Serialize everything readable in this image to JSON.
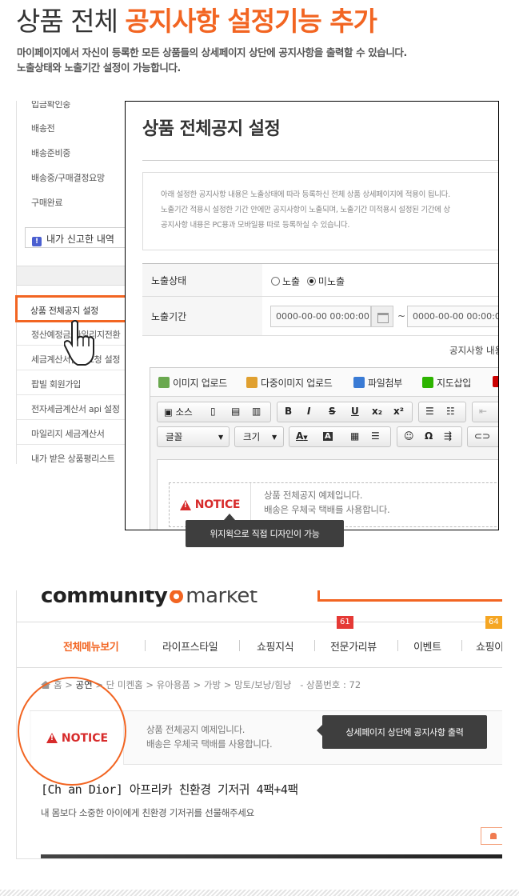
{
  "header": {
    "title_plain": "상품 전체 ",
    "title_highlight": "공지사항 설정기능 추가",
    "desc_line1": "마이페이지에서 자신이 등록한 모든 상품들의 상세페이지 상단에 공지사항을 출력할 수 있습니다.",
    "desc_line2": "노출상태와 노출기간 설정이 가능합니다."
  },
  "left_menu": {
    "items_top": [
      "입금확인중",
      "배송전",
      "배송준비중",
      "배송중/구매결정요망",
      "구매완료"
    ],
    "report_label": "내가 신고한 내역",
    "items_bottom": [
      "상품 전체공지 설정",
      "정산예정금/마일리지전환",
      "세금계산서발행요청 설정",
      "팝빌 회원가입",
      "전자세금계산서 api 설정",
      "마일리지 세금계산서",
      "내가 받은 상품평리스트"
    ]
  },
  "popup": {
    "title": "상품 전체공지 설정",
    "info_lines": [
      "아래 설정한 공지사항 내용은 노출상태에 따라 등록하신 전체 상품 상세페이지에 적용이 됩니다.",
      "노출기간 적용시 설정한 기간 안에만 공지사항이 노출되며, 노출기간 미적용시 설정된 기간에 상",
      "공지사항 내용은 PC용과 모바일용 따로 등록하실 수 있습니다."
    ],
    "status_label": "노출상태",
    "status_options": [
      "노출",
      "미노출"
    ],
    "status_selected": "미노출",
    "period_label": "노출기간",
    "period_start": "0000-00-00 00:00:00",
    "period_sep": "~",
    "period_end": "0000-00-00 00:00:00",
    "content_label": "공지사항 내용",
    "upload_buttons": [
      "이미지 업로드",
      "다중이미지 업로드",
      "파일첨부",
      "지도삽입"
    ],
    "toolbar": {
      "source": "소스",
      "bold": "B",
      "italic": "I",
      "strike": "S",
      "underline": "U",
      "subscript": "x₂",
      "superscript": "x²",
      "font_select": "글꼴",
      "size_select": "크기",
      "text_color": "A",
      "bg_color": "A",
      "omega": "Ω"
    },
    "notice_label": "NOTICE",
    "notice_line1": "상품 전체공지 예제입니다.",
    "notice_line2": "배송은 우체국 택배를 사용합니다."
  },
  "tooltip_design": "위지윅으로 직접 디자인이 가능",
  "shop": {
    "logo_left": "community",
    "logo_right": "market",
    "nav_items": [
      "전체메뉴보기",
      "라이프스타일",
      "쇼핑지식",
      "전문가리뷰",
      "이벤트",
      "쇼핑이"
    ],
    "nav_badge_review": "61",
    "nav_badge_event": "64",
    "colors": {
      "accent": "#f26522",
      "badge_red": "#e53935",
      "badge_orange": "#f5a623"
    },
    "breadcrumb_home": "홈",
    "breadcrumb_items": [
      "공연",
      "단",
      "미켄홈",
      "유아용품",
      "가방",
      "망토/보냥/힘냥"
    ],
    "breadcrumb_sep": ">",
    "product_no_label": "- 상품번호 : 72",
    "notice_label": "NOTICE",
    "notice_line1": "상품 전체공지 예제입니다.",
    "notice_line2": "배송은 우체국 택배를 사용합니다.",
    "product_title": "[Christian Dior] 아프리카 친환경 기저귀 4팩+4팩",
    "product_title_visible": "[Ch     an Dior] 아프리카 친환경 기저귀 4팩+4팩",
    "product_sub": "내 몸보다 소중한 아이에게 친환경 기저귀를 선물해주세요"
  },
  "tooltip_output": "상세페이지 상단에 공지사항 출력"
}
